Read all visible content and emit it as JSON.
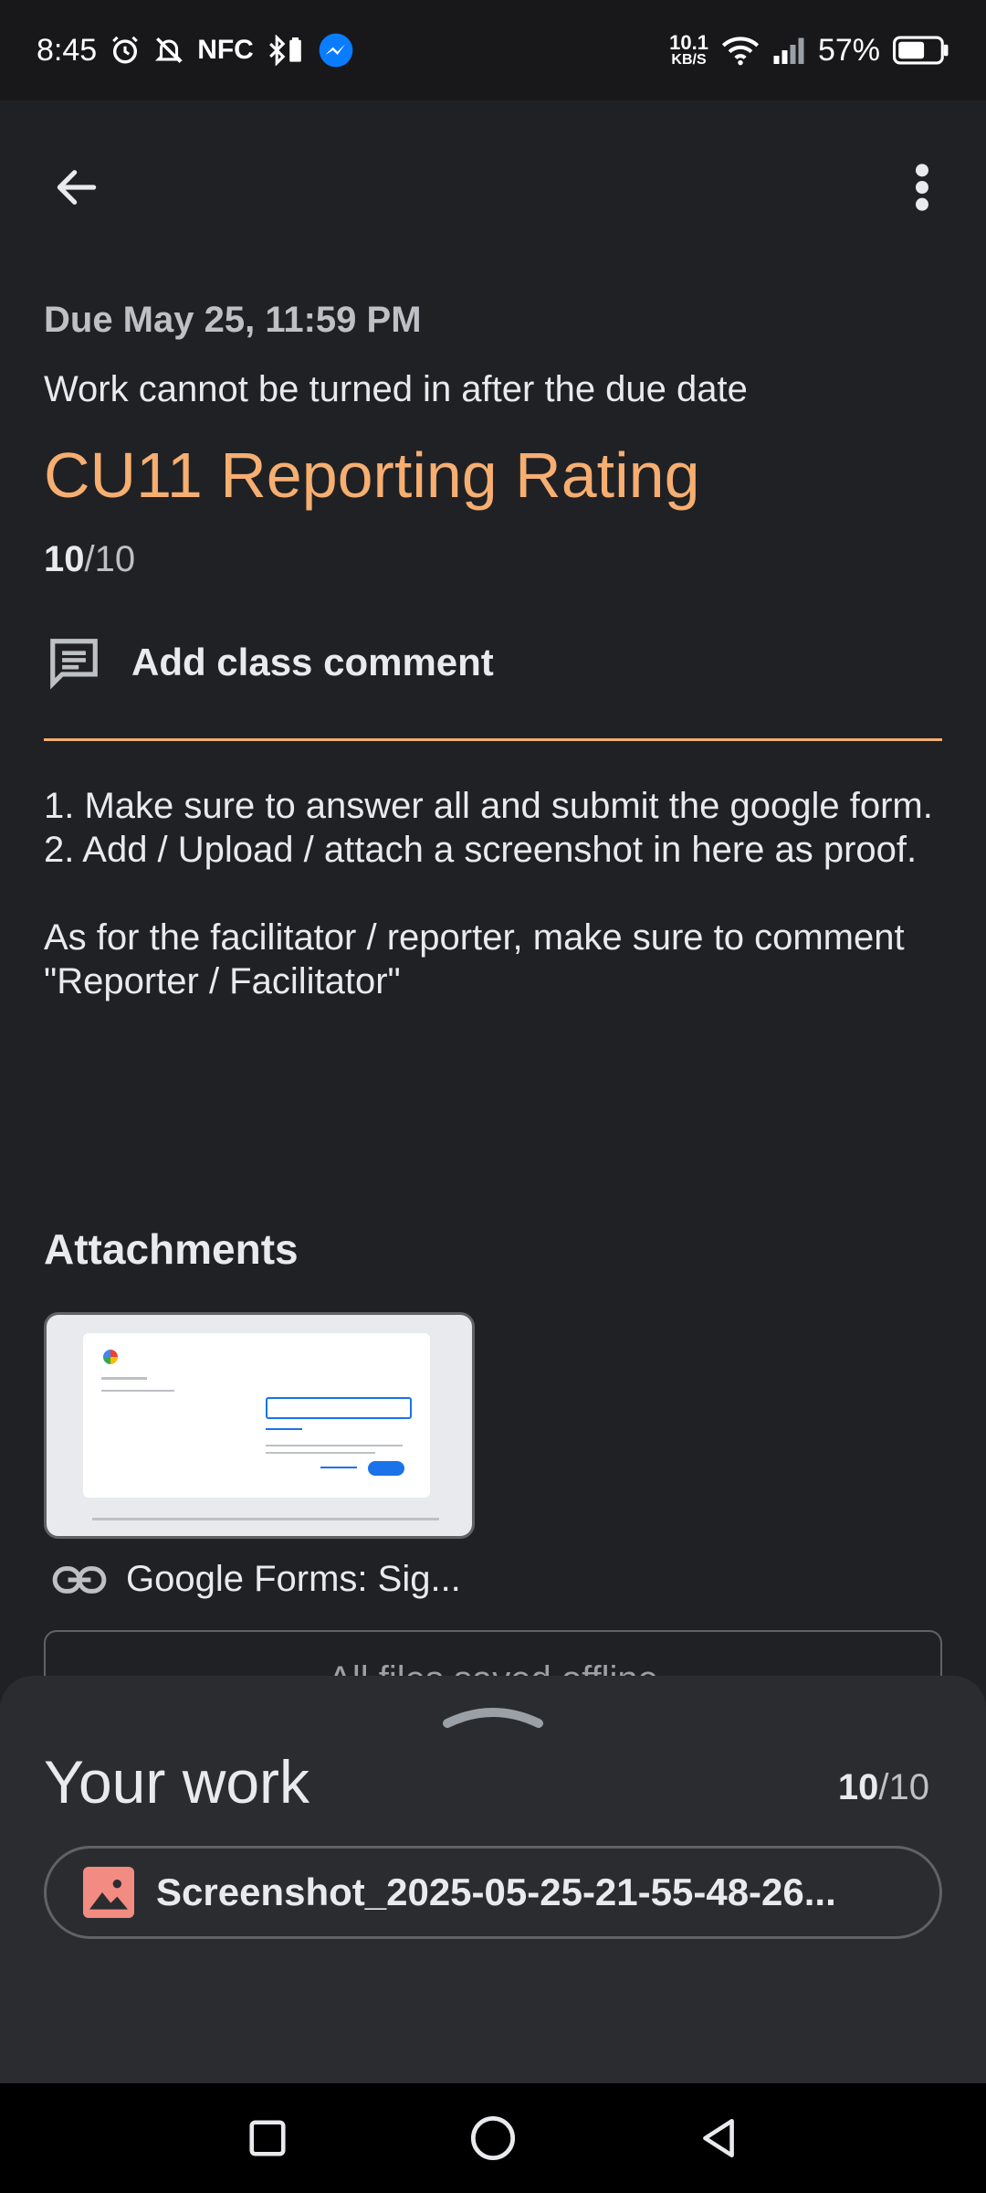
{
  "status_bar": {
    "time": "8:45",
    "nfc": "NFC",
    "speed_value": "10.1",
    "speed_unit": "KB/S",
    "battery": "57%"
  },
  "assignment": {
    "due": "Due May 25, 11:59 PM",
    "late_note": "Work cannot be turned in after the due date",
    "title": "CU11 Reporting Rating",
    "points_earned": "10",
    "points_total": "/10",
    "comment_label": "Add class comment",
    "instructions": "1. Make sure to answer all and submit the google form.\n2. Add / Upload / attach a screenshot in here as proof.\n\nAs for the facilitator / reporter, make sure to comment \"Reporter / Facilitator\""
  },
  "attachments": {
    "heading": "Attachments",
    "link_label": "Google Forms: Sig...",
    "thumb_title": "Sign in",
    "offline_text": "All files saved offline"
  },
  "your_work": {
    "heading": "Your work",
    "points_earned": "10",
    "points_total": "/10",
    "file_name": "Screenshot_2025-05-25-21-55-48-26..."
  },
  "colors": {
    "accent": "#f6ae71",
    "background": "#202124",
    "sheet": "#2b2c2f",
    "image_file": "#f28b82"
  }
}
